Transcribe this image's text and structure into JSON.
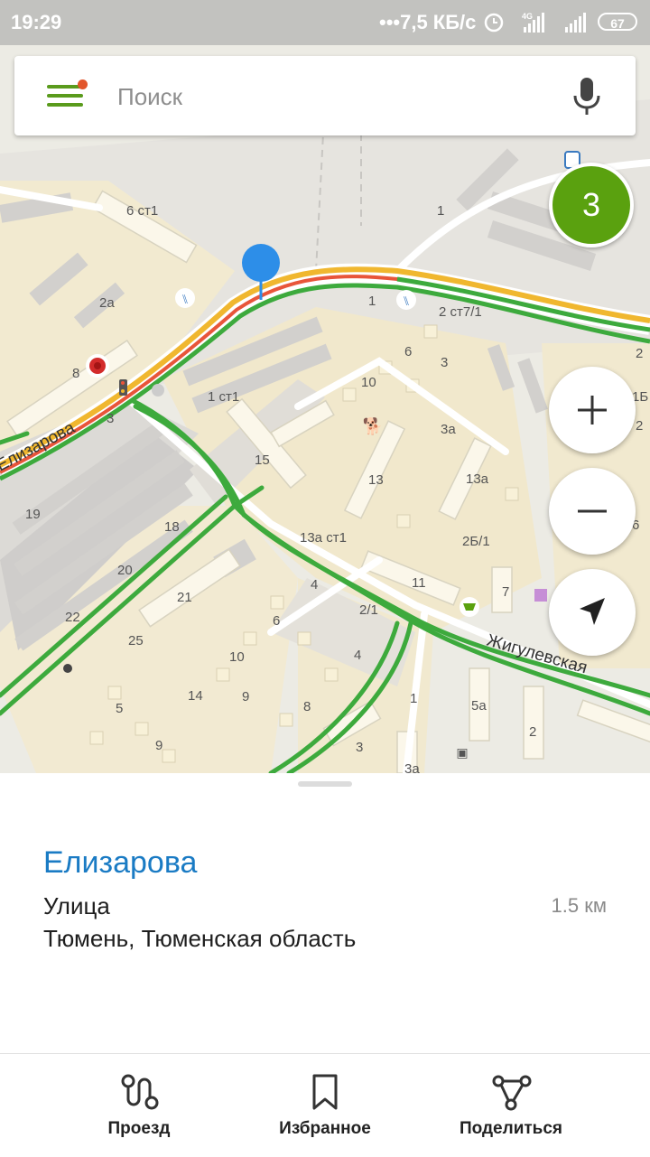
{
  "status_bar": {
    "time": "19:29",
    "speed": "•••7,5 КБ/с",
    "network": "4G",
    "battery": "67"
  },
  "search": {
    "placeholder": "Поиск"
  },
  "traffic_score": "3",
  "map": {
    "streets": {
      "elizarova": "Елизарова",
      "zhigulevskaya": "Жигулевская"
    },
    "house_numbers": [
      "6 ст1",
      "1",
      "2а",
      "1",
      "2 ст7/1",
      "2",
      "8",
      "3",
      "6",
      "3",
      "10",
      "1 ст1",
      "1Б",
      "3а",
      "15",
      "13",
      "13а",
      "19",
      "18",
      "13а ст1",
      "2Б/1",
      "20",
      "21",
      "11",
      "7",
      "2/1",
      "22",
      "25",
      "6",
      "10",
      "4",
      "14",
      "9",
      "5а",
      "4",
      "5",
      "8",
      "1",
      "2",
      "9",
      "3",
      "3а",
      "6",
      "2",
      "8"
    ]
  },
  "place": {
    "title": "Елизарова",
    "type": "Улица",
    "distance": "1.5 км",
    "address": "Тюмень, Тюменская область"
  },
  "bottom_nav": {
    "route": "Проезд",
    "favorites": "Избранное",
    "share": "Поделиться"
  },
  "colors": {
    "accent": "#5a9b1c",
    "title": "#1a7bc4",
    "road_traffic_ok": "#3daa3d",
    "road_main": "#f0b72f",
    "road_slow": "#e8553a",
    "pin": "#2d8ee8"
  }
}
